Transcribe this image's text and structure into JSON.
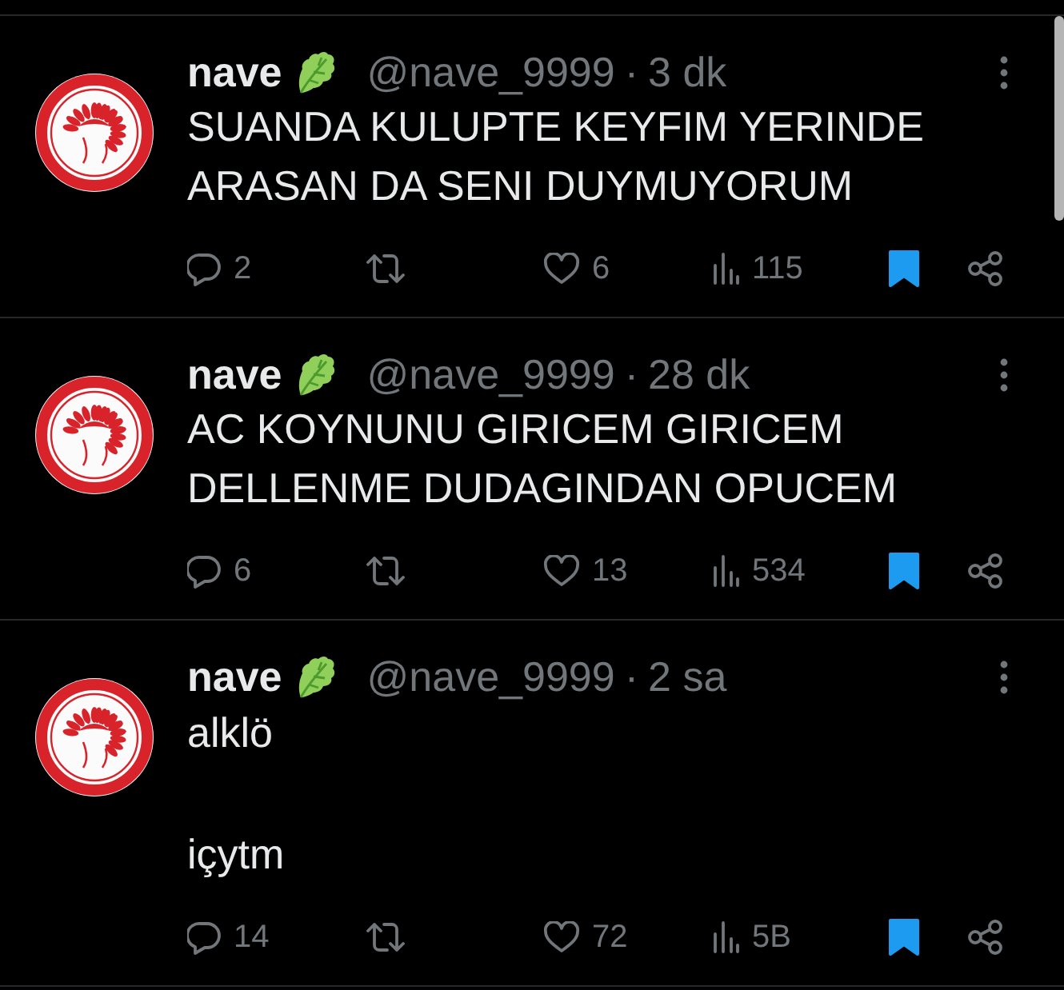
{
  "tweets": [
    {
      "author": {
        "name": "nave",
        "handle": "@nave_9999"
      },
      "separator": "·",
      "time": "3 dk",
      "text": "SUANDA KULUPTE KEYFIM YERINDE\nARASAN DA SENI DUYMUYORUM",
      "actions": [
        {
          "kind": "reply",
          "count": "2"
        },
        {
          "kind": "repost"
        },
        {
          "kind": "like",
          "count": "6"
        },
        {
          "kind": "views",
          "count": "115"
        },
        {
          "kind": "bookmark",
          "bookmarked": true
        },
        {
          "kind": "share"
        }
      ]
    },
    {
      "author": {
        "name": "nave",
        "handle": "@nave_9999"
      },
      "separator": "·",
      "time": "28 dk",
      "text": "AC KOYNUNU GIRICEM GIRICEM\nDELLENME DUDAGINDAN OPUCEM",
      "actions": [
        {
          "kind": "reply",
          "count": "6"
        },
        {
          "kind": "repost"
        },
        {
          "kind": "like",
          "count": "13"
        },
        {
          "kind": "views",
          "count": "534"
        },
        {
          "kind": "bookmark",
          "bookmarked": true
        },
        {
          "kind": "share"
        }
      ]
    },
    {
      "author": {
        "name": "nave",
        "handle": "@nave_9999"
      },
      "separator": "·",
      "time": "2 sa",
      "text": "alklö\n\niçytm",
      "actions": [
        {
          "kind": "reply",
          "count": "14"
        },
        {
          "kind": "repost"
        },
        {
          "kind": "like",
          "count": "72"
        },
        {
          "kind": "views",
          "count": "5B"
        },
        {
          "kind": "bookmark",
          "bookmarked": true
        },
        {
          "kind": "share"
        }
      ]
    }
  ]
}
